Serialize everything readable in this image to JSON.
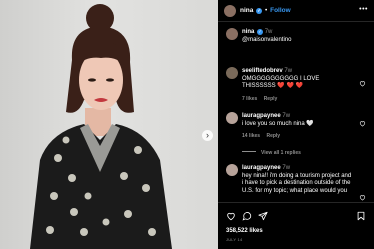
{
  "header": {
    "username": "nina",
    "separator": "•",
    "follow_label": "Follow",
    "more_icon": "more-horizontal-icon"
  },
  "caption": {
    "username": "nina",
    "time": "7w",
    "text": "@maisonvalentino"
  },
  "comments": [
    {
      "username": "seeliftedobrev",
      "time": "7w",
      "text": "OMGGGGGGGGGG I LOVE THISSSSSS",
      "emoji": "❤️ ❤️ ❤️",
      "likes": "7 likes",
      "reply_label": "Reply"
    },
    {
      "username": "lauragpaynee",
      "time": "7w",
      "text": "i love you so much nina 🤍",
      "likes": "14 likes",
      "reply_label": "Reply",
      "view_replies": "View all 1 replies"
    },
    {
      "username": "lauragpaynee",
      "time": "7w",
      "text": "hey nina!! i'm doing a tourism project and i have to pick a destination outside of the U.S. for my topic; what place would you"
    }
  ],
  "footer": {
    "likes_count": "358,522 likes",
    "date": "JULY 14"
  },
  "colors": {
    "accent": "#3897f0",
    "muted": "#8e8e8e",
    "background": "#000000"
  },
  "icons": [
    "heart-icon",
    "comment-icon",
    "share-icon",
    "bookmark-icon",
    "chevron-right-icon",
    "verified-badge-icon"
  ]
}
